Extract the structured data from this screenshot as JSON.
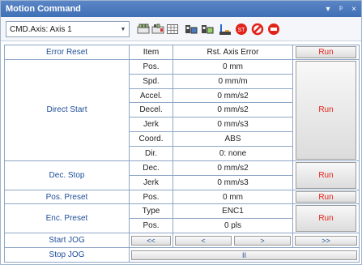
{
  "window": {
    "title": "Motion Command",
    "pin": "▾",
    "dock": "ᵖ",
    "close": "×"
  },
  "toolbar": {
    "axis_select": {
      "value": "CMD.Axis: Axis 1"
    }
  },
  "header": {
    "item": "Item",
    "value": "Rst. Axis Error",
    "run": "Run"
  },
  "commands": {
    "error_reset": "Error Reset",
    "direct_start": "Direct Start",
    "dec_stop": "Dec. Stop",
    "pos_preset": "Pos. Preset",
    "enc_preset": "Enc. Preset",
    "start_jog": "Start JOG",
    "stop_jog": "Stop JOG"
  },
  "direct_start": {
    "rows": [
      {
        "param": "Pos.",
        "value": "0 mm"
      },
      {
        "param": "Spd.",
        "value": "0 mm/m"
      },
      {
        "param": "Accel.",
        "value": "0 mm/s2"
      },
      {
        "param": "Decel.",
        "value": "0 mm/s2"
      },
      {
        "param": "Jerk",
        "value": "0 mm/s3"
      },
      {
        "param": "Coord.",
        "value": "ABS"
      },
      {
        "param": "Dir.",
        "value": "0: none"
      }
    ],
    "run": "Run"
  },
  "dec_stop": {
    "rows": [
      {
        "param": "Dec.",
        "value": "0 mm/s2"
      },
      {
        "param": "Jerk",
        "value": "0 mm/s3"
      }
    ],
    "run": "Run"
  },
  "pos_preset": {
    "param": "Pos.",
    "value": "0 mm",
    "run": "Run"
  },
  "enc_preset": {
    "rows": [
      {
        "param": "Type",
        "value": "ENC1"
      },
      {
        "param": "Pos.",
        "value": "0 pls"
      }
    ],
    "run": "Run"
  },
  "jog": {
    "fast_back": "<<",
    "back": "<",
    "forward": ">",
    "fast_forward": ">>",
    "stop": "II"
  },
  "colors": {
    "title_bar": "#4a7bbf",
    "command_text": "#1f4e99",
    "run_text": "#e2231a",
    "grid_line": "#8fa6c6"
  }
}
